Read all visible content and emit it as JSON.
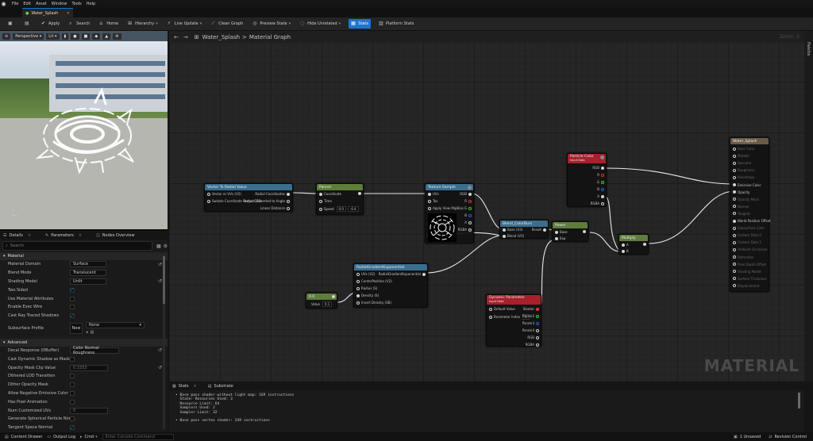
{
  "menu": [
    "File",
    "Edit",
    "Asset",
    "Window",
    "Tools",
    "Help"
  ],
  "doc_tab": "Water_Splash",
  "toolbar": {
    "apply": "Apply",
    "home": "Home",
    "search": "Search",
    "hierarchy": "Hierarchy",
    "live_update": "Live Update",
    "clean_graph": "Clean Graph",
    "preview_state": "Preview State",
    "hide_unrelated": "Hide Unrelated",
    "stats": "Stats",
    "platform_stats": "Platform Stats"
  },
  "viewport": {
    "perspective": "Perspective",
    "lit": "Lit"
  },
  "panel_tabs": [
    "Details",
    "Parameters",
    "Nodes Overview"
  ],
  "details": {
    "search_placeholder": "Search",
    "section_material": "Material",
    "section_advanced": "Advanced",
    "material_rows": [
      {
        "label": "Material Domain",
        "value": "Surface"
      },
      {
        "label": "Blend Mode",
        "value": "Translucent"
      },
      {
        "label": "Shading Model",
        "value": "Unlit"
      },
      {
        "label": "Two Sided",
        "value": "✓"
      },
      {
        "label": "Use Material Attributes",
        "value": ""
      },
      {
        "label": "Enable Exec Wire",
        "value": ""
      },
      {
        "label": "Cast Ray Traced Shadows",
        "value": "✓"
      }
    ],
    "subsurface_label": "Subsurface Profile",
    "subsurface_none": "None",
    "subsurface_new": "New",
    "advanced_rows": [
      {
        "label": "Decal Response (DBuffer)",
        "value": "Color Normal Roughness"
      },
      {
        "label": "Cast Dynamic Shadow as Masked",
        "value": ""
      },
      {
        "label": "Opacity Mask Clip Value",
        "value": "0.3333"
      },
      {
        "label": "Dithered LOD Transition",
        "value": ""
      },
      {
        "label": "Dither Opacity Mask",
        "value": ""
      },
      {
        "label": "Allow Negative Emissive Color",
        "value": ""
      },
      {
        "label": "Has Pixel Animation",
        "value": ""
      },
      {
        "label": "Num Customized UVs",
        "value": "0"
      },
      {
        "label": "Generate Spherical Particle Norm.",
        "value": ""
      },
      {
        "label": "Tangent Space Normal",
        "value": "✓"
      }
    ]
  },
  "graph": {
    "breadcrumb_asset": "Water_Splash",
    "breadcrumb_sep": ">",
    "breadcrumb_graph": "Material Graph",
    "zoom": "Zoom -2",
    "watermark": "MATERIAL",
    "palette": "Palette"
  },
  "nodes": {
    "v2r": {
      "title": "Vector To Radial Value",
      "in1": "Vector or UVs (V2)",
      "in2": "Swizzle Coordinate Output (SB)",
      "out1": "Radial Coordinates",
      "out2": "Vector Converted to Angle",
      "out3": "Linear Distance"
    },
    "panner": {
      "title": "Panner",
      "in1": "Coordinate",
      "in2": "Time",
      "in3": "Speed",
      "sx": "0.0",
      "sy": "-0.4"
    },
    "tex": {
      "title": "Texture Sample",
      "in1": "UVs",
      "in2": "Tex",
      "in3": "Apply View MipBias",
      "out1": "RGB",
      "out2": "R",
      "out3": "G",
      "out4": "B",
      "out5": "A",
      "out6": "RGBA"
    },
    "blend": {
      "title": "Blend_ColorBurn",
      "in1": "Base (V3)",
      "in2": "Blend (V3)",
      "out": "Result"
    },
    "rge": {
      "title": "RadialGradientExponential",
      "in1": "UVs (V2)",
      "in2": "CenterPosition (V2)",
      "in3": "Radius (S)",
      "in4": "Density (S)",
      "in5": "Invert Density (SB)",
      "out": "RadialGradientExponential"
    },
    "param": {
      "title": "0.0",
      "label": "Value",
      "value": "0.1"
    },
    "power": {
      "title": "Power",
      "in1": "Base",
      "in2": "Exp"
    },
    "pcolor": {
      "title": "Particle Color",
      "sub": "Input Data",
      "out1": "RGB",
      "out2": "R",
      "out3": "G",
      "out4": "B",
      "out5": "A",
      "out6": "RGBA"
    },
    "mult": {
      "title": "Multiply",
      "in1": "A",
      "in2": "B"
    },
    "dyn": {
      "title": "Dynamic Parameter",
      "sub": "Input Data",
      "in1": "Default Value",
      "in2": "Parameter Index",
      "idx": "0",
      "out1": "Slooter",
      "out2": "Param2",
      "out3": "Param3",
      "out4": "Param4",
      "out5": "RGB",
      "out6": "RGBA"
    },
    "result": {
      "title": "Water_Splash",
      "pins": [
        "Base Color",
        "Metallic",
        "Specular",
        "Roughness",
        "Anisotropy",
        "Emissive Color",
        "Opacity",
        "Opacity Mask",
        "Normal",
        "Tangent",
        "World Position Offset",
        "Subsurface Color",
        "Custom Data 0",
        "Custom Data 1",
        "Ambient Occlusion",
        "Refraction",
        "Pixel Depth Offset",
        "Shading Model",
        "Surface Thickness",
        "Displacement"
      ]
    }
  },
  "bottom": {
    "tab_stats": "Stats",
    "tab_substrate": "Substrate",
    "stats_lines": [
      "• Base pass shader without light map: 169 instructions",
      "  State: Resources Used: 3",
      "  Resource Limit: 64",
      "  Samplers Used: 2",
      "  Sampler Limit: 32",
      "",
      "• Base pass vertex shader: 349 instructions"
    ]
  },
  "statusbar": {
    "content_drawer": "Content Drawer",
    "output_log": "Output Log",
    "cmd": "Cmd",
    "console_placeholder": "Enter Console Command",
    "unsaved": "1 Unsaved",
    "revision": "Revision Control"
  },
  "colors": {
    "accent": "#1c74d4",
    "function_header": "#3b6e8e",
    "panner_header": "#5f7d3b",
    "input_header": "#a7202c"
  }
}
